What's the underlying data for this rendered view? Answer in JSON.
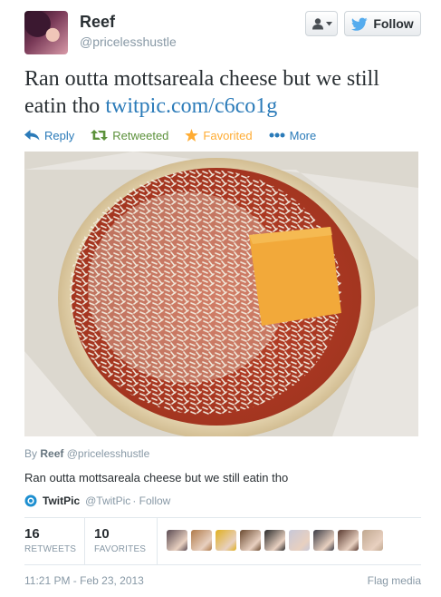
{
  "user": {
    "name": "Reef",
    "handle": "@pricelesshustle",
    "follow_label": "Follow"
  },
  "tweet": {
    "text": "Ran outta mottsareala cheese but we still eatin tho",
    "link": "twitpic.com/c6co1g"
  },
  "actions": {
    "reply": "Reply",
    "retweeted": "Retweeted",
    "favorited": "Favorited",
    "more": "More"
  },
  "media": {
    "by_label": "By",
    "author_name": "Reef",
    "author_handle": "@pricelesshustle",
    "caption": "Ran outta mottsareala cheese but we still eatin tho",
    "provider_name": "TwitPic",
    "provider_handle": "@TwitPic",
    "provider_follow": "· Follow"
  },
  "stats": {
    "retweets_count": "16",
    "retweets_label": "RETWEETS",
    "favorites_count": "10",
    "favorites_label": "FAVORITES"
  },
  "favoriters": [
    "#5a4a52",
    "#b07a4a",
    "#e0b020",
    "#6b4a30",
    "#2a2a2a",
    "#c8c8d8",
    "#3a3a44",
    "#5a3a30",
    "#c0a890"
  ],
  "footer": {
    "timestamp": "11:21 PM - Feb 23, 2013",
    "flag_media": "Flag media"
  },
  "colors": {
    "link": "#2b7bb9",
    "retweeted": "#5c913b",
    "favorited": "#ffac33",
    "follow_bird": "#55acee"
  }
}
